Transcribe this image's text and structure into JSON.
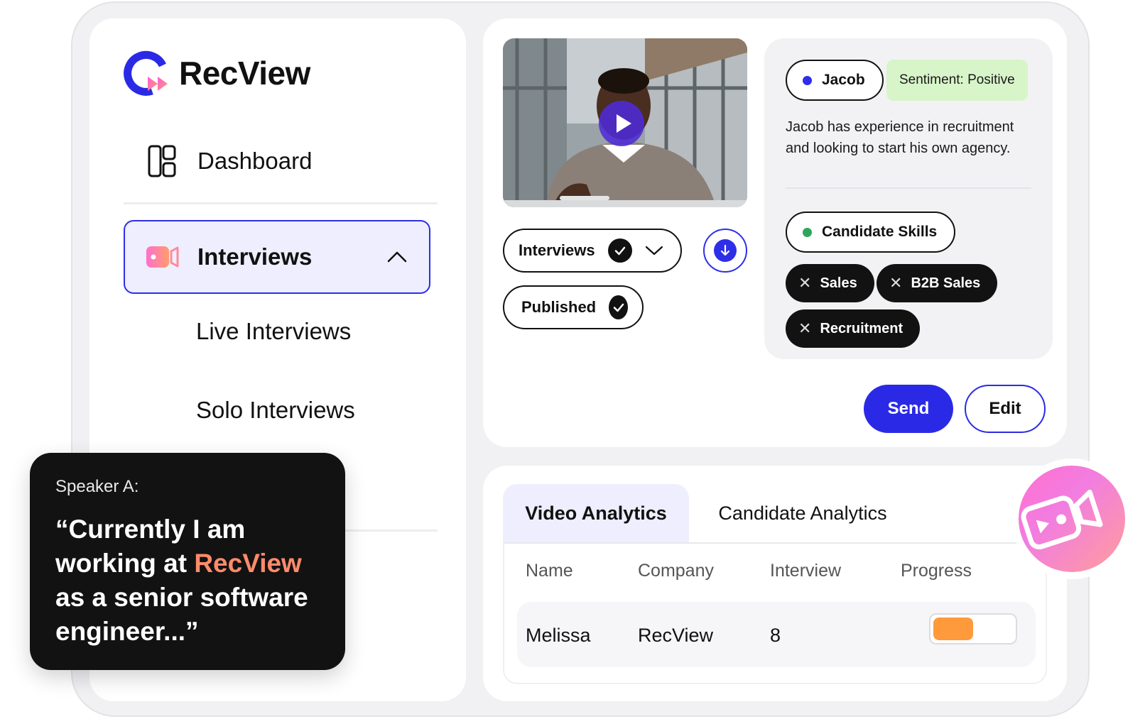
{
  "app": {
    "logo_text": "RecView",
    "accent": "#2e2ee8",
    "brand_gradient": [
      "#ff6fcf",
      "#ff9d6b"
    ]
  },
  "sidebar": {
    "items": [
      {
        "label": "Dashboard",
        "icon": "dashboard-grid-icon"
      },
      {
        "label": "Interviews",
        "icon": "video-camera-icon",
        "expanded": true,
        "active": true
      },
      {
        "label": "Live Interviews"
      },
      {
        "label": "Solo Interviews"
      }
    ]
  },
  "quote": {
    "speaker": "Speaker A:",
    "line_before": "“Currently I am working at ",
    "brand": "RecView",
    "line_after": " as a senior software engineer...”"
  },
  "video_panel": {
    "play_icon": "play-icon",
    "interviews_filter_label": "Interviews",
    "published_label": "Published",
    "download_icon": "download-arrow-icon"
  },
  "profile": {
    "name": "Jacob",
    "name_dot_color": "#2e2ee8",
    "sentiment": "Sentiment: Positive",
    "summary": "Jacob has experience in recruitment and looking to start his own agency.",
    "skills_label": "Candidate Skills",
    "skills_dot_color": "#2fa55a",
    "skills": [
      "Sales",
      "B2B Sales",
      "Recruitment"
    ]
  },
  "actions": {
    "send_label": "Send",
    "edit_label": "Edit"
  },
  "analytics": {
    "tabs": [
      "Video Analytics",
      "Candidate Analytics"
    ],
    "active_tab": "Video Analytics",
    "columns": [
      "Name",
      "Company",
      "Interview",
      "Progress"
    ],
    "rows": [
      {
        "name": "Melissa",
        "company": "RecView",
        "interview": "8",
        "progress": 0.5,
        "progress_color": "#ff9a3c"
      }
    ]
  }
}
